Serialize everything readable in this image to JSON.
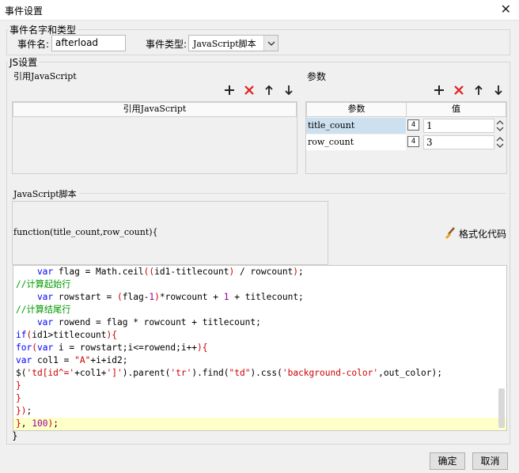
{
  "window": {
    "title": "事件设置",
    "close_glyph": "✕"
  },
  "event_group": {
    "legend": "事件名字和类型",
    "name_label": "事件名:",
    "name_value": "afterload",
    "type_label": "事件类型:",
    "type_value": "JavaScript脚本"
  },
  "js_group": {
    "legend": "JS设置",
    "ref_title": "引用JavaScript",
    "ref_column": "引用JavaScript",
    "params_title": "参数",
    "params_columns": [
      "参数",
      "值"
    ],
    "params_rows": [
      {
        "name": "title_count",
        "value": "1"
      },
      {
        "name": "row_count",
        "value": "3"
      }
    ],
    "script_title": "JavaScript脚本",
    "function_signature": "function(title_count,row_count){",
    "format_label": "格式化代码",
    "closing_brace": "}"
  },
  "code_lines": [
    "    var flag = Math.ceil((id1-titlecount) / rowcount);",
    "//计算起始行",
    "    var rowstart = (flag-1)*rowcount + 1 + titlecount;",
    "//计算结尾行",
    "    var rowend = flag * rowcount + titlecount;",
    "if(id1>titlecount){",
    "for(var i = rowstart;i<=rowend;i++){",
    "var col1 = \"A\"+i+id2;",
    "$('td[id^='+col1+']').parent('tr').find(\"td\").css('background-color',out_color);",
    "}",
    "}",
    "});",
    "}, 100);"
  ],
  "buttons": {
    "ok": "确定",
    "cancel": "取消"
  }
}
